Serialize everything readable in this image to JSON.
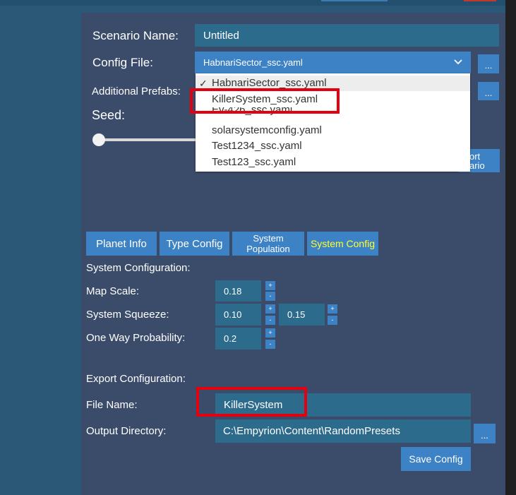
{
  "scenario": {
    "label": "Scenario Name:",
    "value": "Untitled"
  },
  "config_file": {
    "label": "Config File:",
    "selected": "HabnariSector_ssc.yaml",
    "browse": "...",
    "options": [
      "HabnariSector_ssc.yaml",
      "KillerSystem_ssc.yaml",
      "Ev-426_ssc.yaml",
      "solarsystemconfig.yaml",
      "Test1234_ssc.yaml",
      "Test123_ssc.yaml"
    ]
  },
  "prefabs": {
    "label": "Additional Prefabs:",
    "browse": "..."
  },
  "seed": {
    "label": "Seed:",
    "value": 0.0
  },
  "export_scenario": {
    "label_line1": "ort",
    "label_line2": "ario"
  },
  "tabs": {
    "planet_info": "Planet Info",
    "type_config": "Type Config",
    "system_population_1": "System",
    "system_population_2": "Population",
    "system_config": "System Config"
  },
  "system_configuration": {
    "heading": "System Configuration:",
    "map_scale": {
      "label": "Map Scale:",
      "value": "0.18"
    },
    "system_squeeze": {
      "label": "System Squeeze:",
      "value_min": "0.10",
      "value_max": "0.15"
    },
    "one_way": {
      "label": "One Way Probability:",
      "value": "0.2"
    },
    "plus": "+",
    "minus": "-"
  },
  "export_configuration": {
    "heading": "Export Configuration:",
    "file_name": {
      "label": "File Name:",
      "value": "KillerSystem"
    },
    "output_dir": {
      "label": "Output Directory:",
      "value": "C:\\Empyrion\\Content\\RandomPresets",
      "browse": "..."
    },
    "save": "Save Config"
  },
  "icons": {
    "dropdown": "chevron-down-icon",
    "check": "checkmark-icon"
  },
  "colors": {
    "panel_bg": "#3b4c6b",
    "field_bg": "#2d6b8c",
    "button_bg": "#3d82c4",
    "active_tab_text": "#ffff2e",
    "highlight": "#e3000f"
  }
}
